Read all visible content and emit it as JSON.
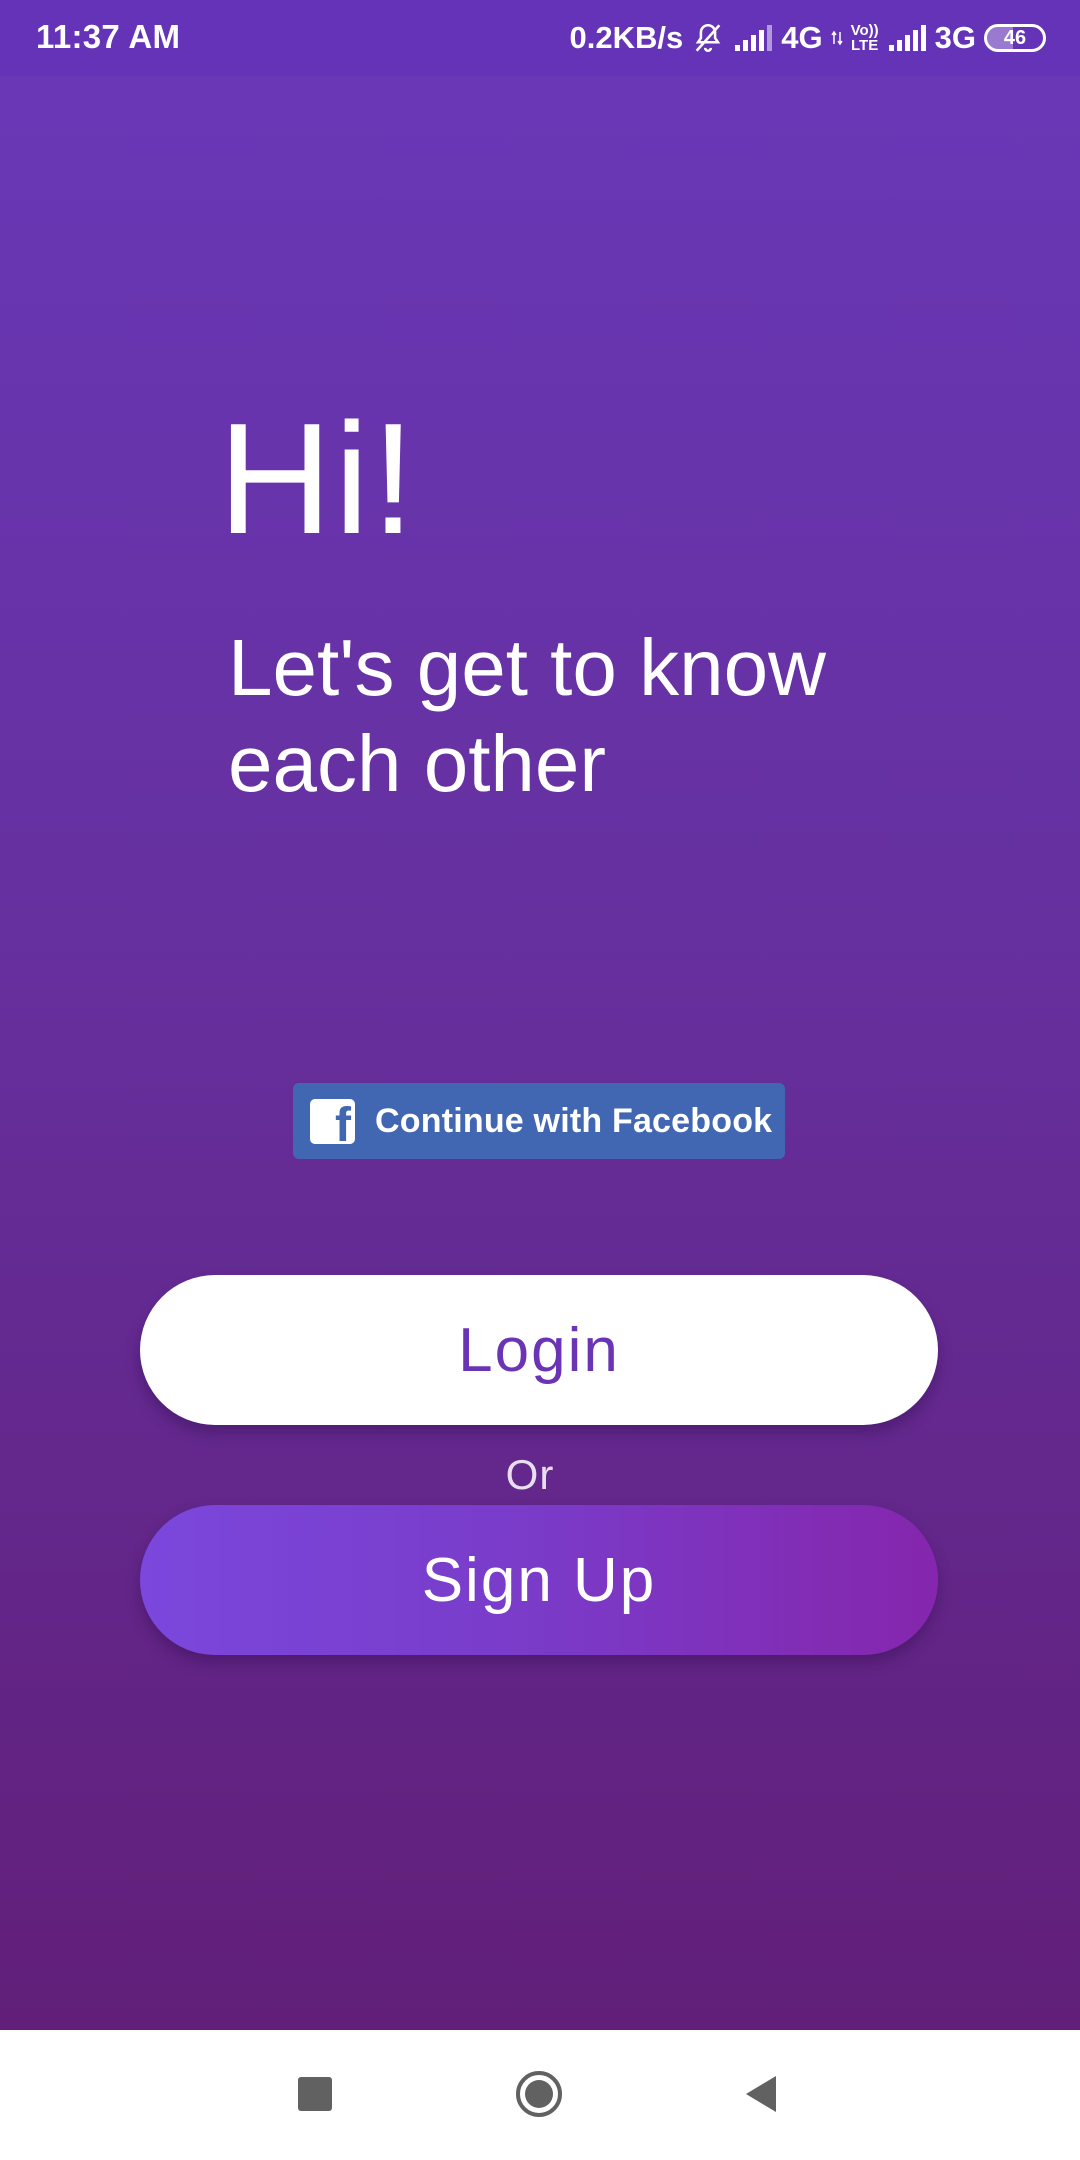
{
  "status_bar": {
    "time": "11:37 AM",
    "network_speed": "0.2KB/s",
    "network_1": "4G",
    "volte_top": "Vo))",
    "volte_bottom": "LTE",
    "network_2": "3G",
    "battery_level": "46",
    "battery_fraction": 0.46,
    "icons": [
      "notifications-off-icon",
      "signal-icon",
      "data-arrows-icon",
      "volte-icon",
      "signal-icon",
      "battery-icon"
    ]
  },
  "greeting": {
    "title": "Hi!",
    "subtitle": "Let's get to know each other"
  },
  "facebook": {
    "label": "Continue with Facebook",
    "logo_letter": "f",
    "color": "#4267b2"
  },
  "auth": {
    "login_label": "Login",
    "or_label": "Or",
    "signup_label": "Sign Up"
  },
  "nav": {
    "icons": [
      "recent-apps-icon",
      "home-icon",
      "back-icon"
    ]
  },
  "colors": {
    "background_top": "#6a38b9",
    "background_bottom": "#611f79",
    "accent": "#6b34b5",
    "signup_gradient_start": "#7b47dc",
    "signup_gradient_end": "#8526ad"
  }
}
